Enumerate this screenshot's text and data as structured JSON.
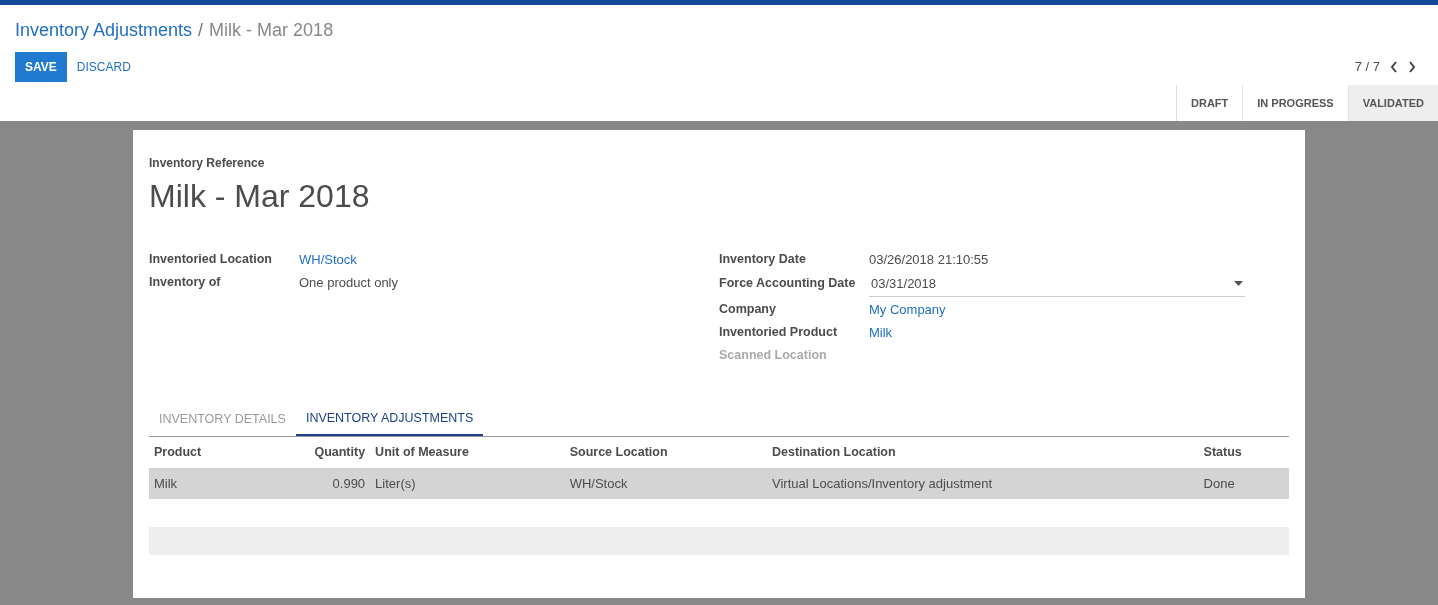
{
  "breadcrumb": {
    "parent": "Inventory Adjustments",
    "separator": "/",
    "current": "Milk - Mar 2018"
  },
  "buttons": [
    {
      "label": "SAVE",
      "kind": "primary"
    },
    {
      "label": "DISCARD",
      "kind": "link"
    }
  ],
  "pager": {
    "text": "7 / 7"
  },
  "status_steps": [
    {
      "label": "DRAFT",
      "selected": false
    },
    {
      "label": "IN PROGRESS",
      "selected": false
    },
    {
      "label": "VALIDATED",
      "selected": true
    }
  ],
  "sheet": {
    "reference_label": "Inventory Reference",
    "title": "Milk - Mar 2018",
    "left_fields": [
      {
        "label": "Inventoried Location",
        "value": "WH/Stock",
        "kind": "link"
      },
      {
        "label": "Inventory of",
        "value": "One product only",
        "kind": "text"
      }
    ],
    "right_fields": [
      {
        "label": "Inventory Date",
        "value": "03/26/2018 21:10:55",
        "kind": "text"
      },
      {
        "label": "Force Accounting Date",
        "value": "03/31/2018",
        "kind": "dropdown"
      },
      {
        "label": "Company",
        "value": "My Company",
        "kind": "link"
      },
      {
        "label": "Inventoried Product",
        "value": "Milk",
        "kind": "link"
      },
      {
        "label": "Scanned Location",
        "kind": "empty"
      }
    ]
  },
  "tabs": [
    {
      "label": "INVENTORY DETAILS",
      "selected": false
    },
    {
      "label": "INVENTORY ADJUSTMENTS",
      "selected": true
    }
  ],
  "table": {
    "columns": [
      "Product",
      "Quantity",
      "Unit of Measure",
      "Source Location",
      "Destination Location",
      "Status"
    ],
    "rows": [
      {
        "cells": [
          "Milk",
          "0.990",
          "Liter(s)",
          "WH/Stock",
          "Virtual Locations/Inventory adjustment",
          "Done"
        ],
        "selected": true
      }
    ]
  }
}
